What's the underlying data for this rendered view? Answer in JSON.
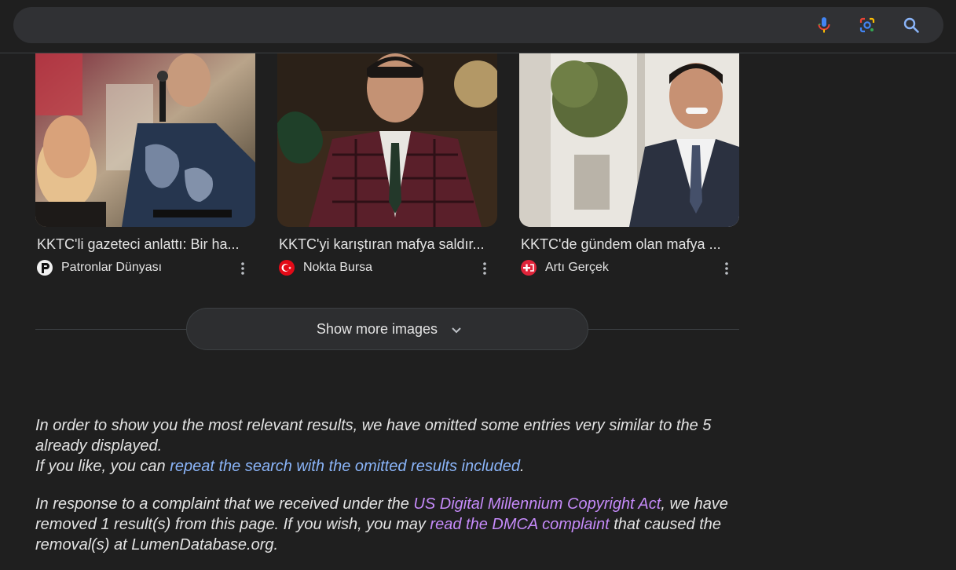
{
  "search": {
    "placeholder": "",
    "mic_icon": "mic-icon",
    "lens_icon": "google-lens-icon",
    "search_icon": "search-icon"
  },
  "images": [
    {
      "title": "KKTC'li gazeteci anlattı: Bir ha...",
      "source": "Patronlar Dünyası",
      "favicon": "patronlar-dunyasi-favicon"
    },
    {
      "title": "KKTC'yi karıştıran mafya saldır...",
      "source": "Nokta Bursa",
      "favicon": "turkish-flag-favicon"
    },
    {
      "title": "KKTC'de gündem olan mafya ...",
      "source": "Artı Gerçek",
      "favicon": "arti-gercek-favicon"
    }
  ],
  "show_more": {
    "label": "Show more images"
  },
  "omitted_notice": {
    "line1": "In order to show you the most relevant results, we have omitted some entries very similar to the 5 already displayed.",
    "line2_prefix": "If you like, you can ",
    "line2_link": "repeat the search with the omitted results included",
    "line2_suffix": "."
  },
  "dmca_notice": {
    "prefix": "In response to a complaint that we received under the ",
    "link1": "US Digital Millennium Copyright Act",
    "middle": ", we have removed 1 result(s) from this page. If you wish, you may ",
    "link2": "read the DMCA complaint",
    "suffix": " that caused the removal(s) at LumenDatabase.org."
  },
  "colors": {
    "background": "#1f1f1f",
    "search_bg": "#303134",
    "link_blue": "#8ab4f8",
    "link_visited": "#c58af9"
  }
}
